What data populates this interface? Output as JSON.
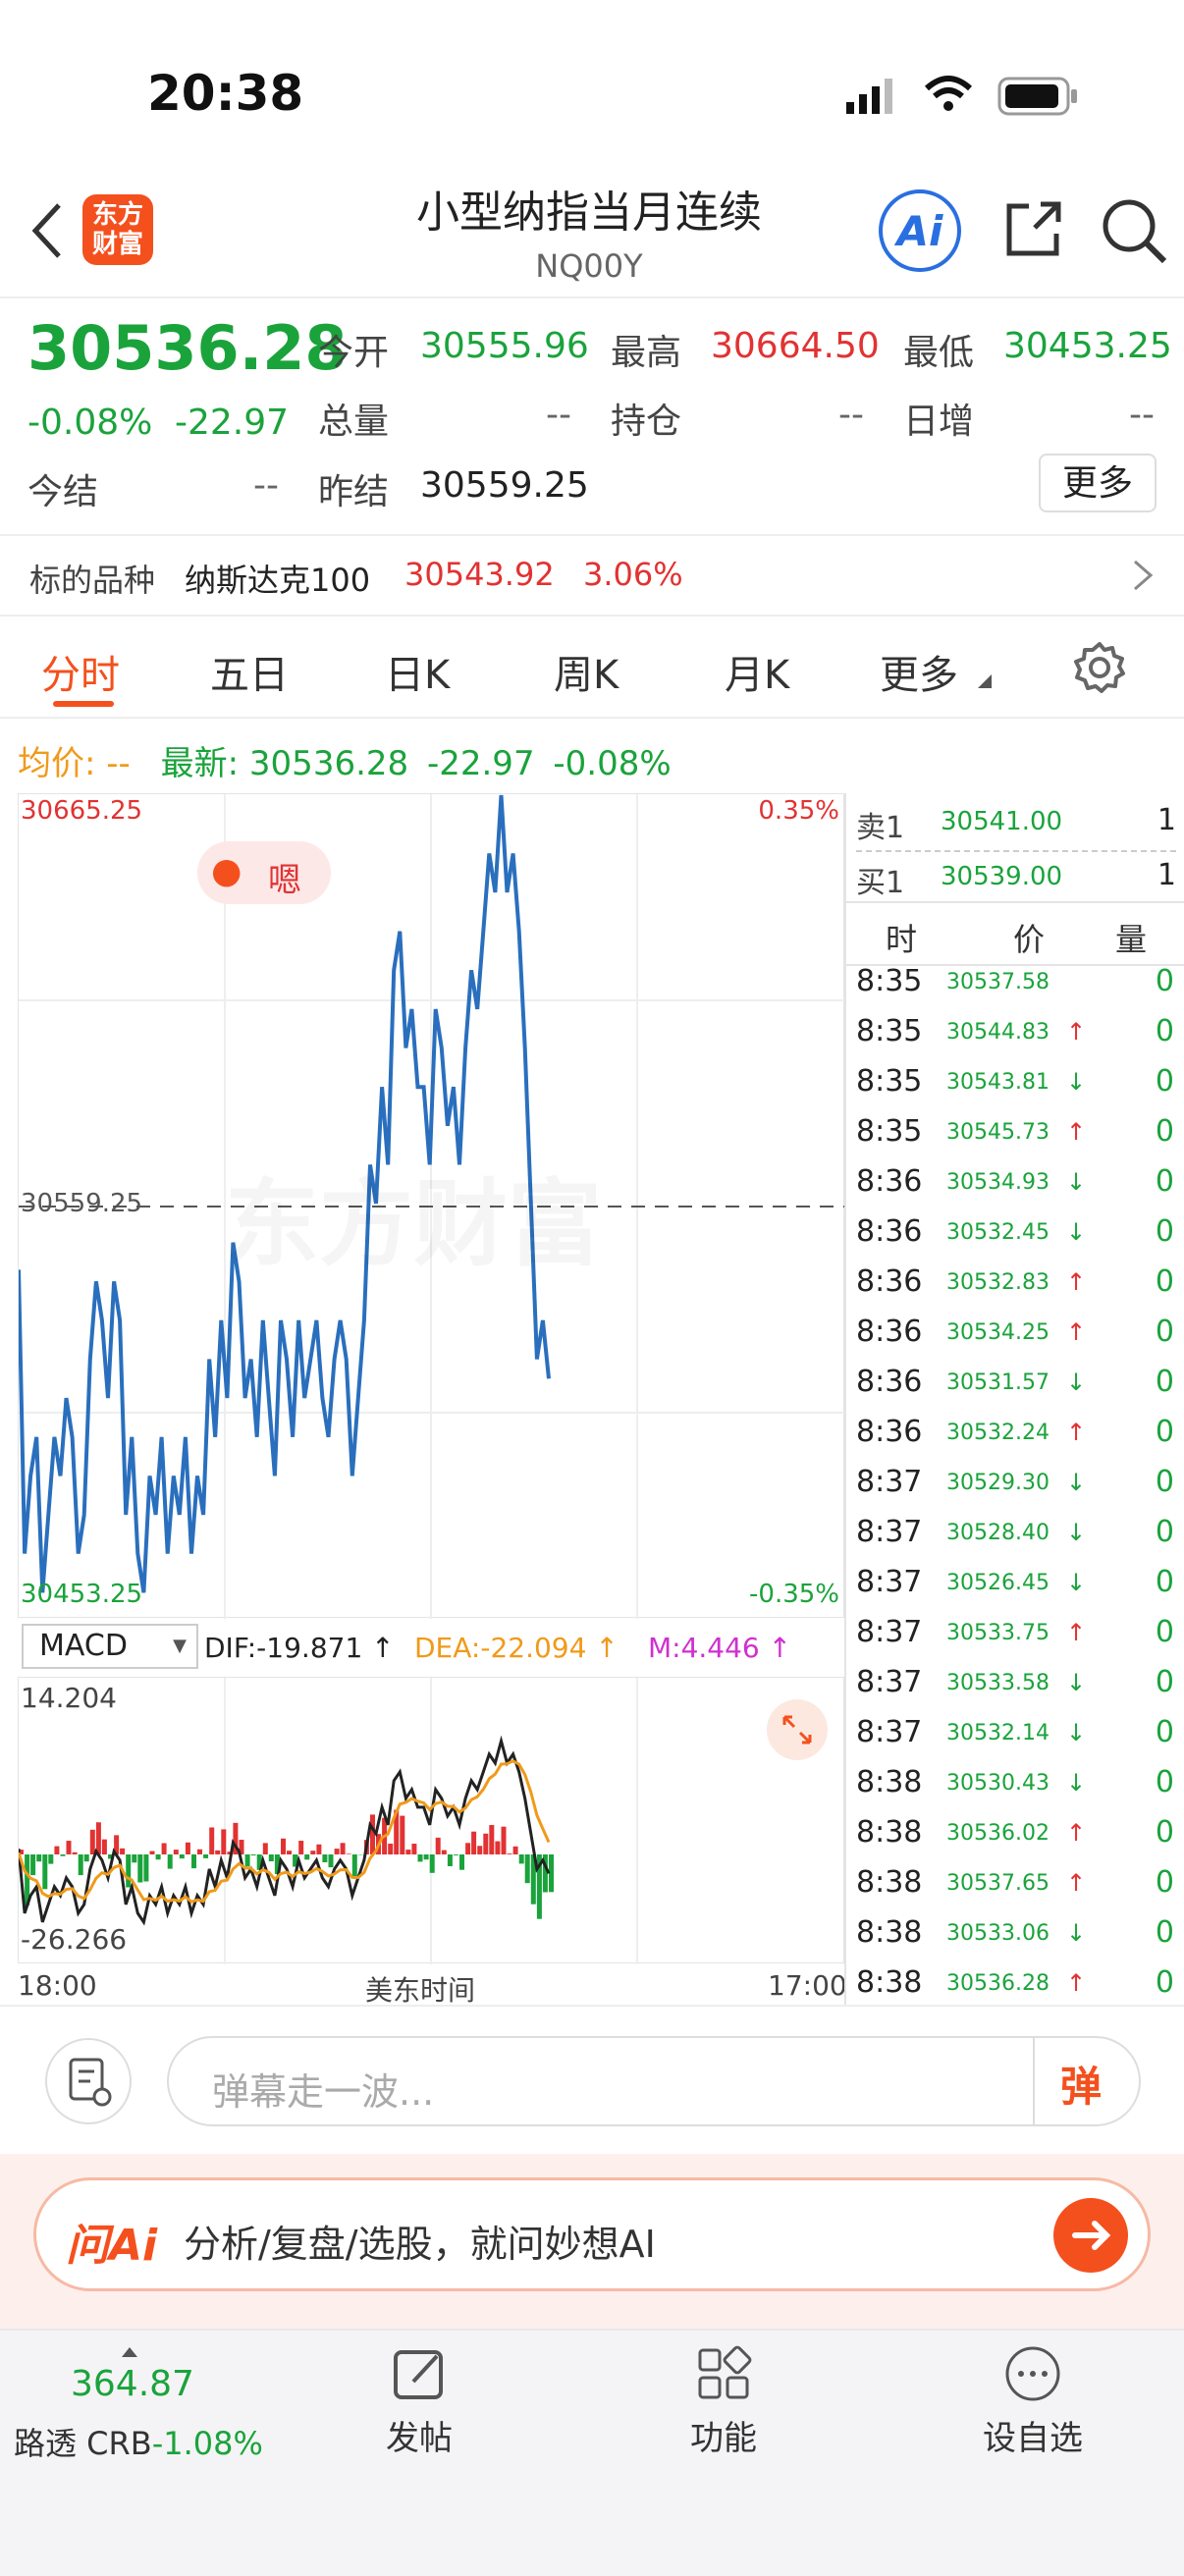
{
  "status_bar": {
    "time": "20:38"
  },
  "header": {
    "logo_line1": "东方",
    "logo_line2": "财富",
    "title": "小型纳指当月连续",
    "code": "NQ00Y",
    "ai_label": "Ai"
  },
  "quote": {
    "last": "30536.28",
    "change_pct": "-0.08%",
    "change": "-22.97",
    "open_label": "今开",
    "open": "30555.96",
    "high_label": "最高",
    "high": "30664.50",
    "low_label": "最低",
    "low": "30453.25",
    "volume_label": "总量",
    "volume": "--",
    "oi_label": "持仓",
    "oi": "--",
    "daily_inc_label": "日增",
    "daily_inc": "--",
    "settle_label": "今结",
    "settle": "--",
    "prev_settle_label": "昨结",
    "prev_settle": "30559.25",
    "more_button": "更多"
  },
  "underlying": {
    "label": "标的品种",
    "name": "纳斯达克100",
    "price": "30543.92",
    "pct": "3.06%"
  },
  "tabs": [
    "分时",
    "五日",
    "日K",
    "周K",
    "月K",
    "更多"
  ],
  "info_line": {
    "avg_label": "均价:",
    "avg_value": "--",
    "latest_label": "最新:",
    "latest_value": "30536.28",
    "change": "-22.97",
    "pct": "-0.08%"
  },
  "chart": {
    "y_max_label": "30665.25",
    "y_mid_label": "30559.25",
    "y_min_label": "30453.25",
    "pct_top": "0.35%",
    "pct_bottom": "-0.35%",
    "mascot_text": "嗯",
    "watermark": "东方财富"
  },
  "chart_data": {
    "type": "line",
    "title": "",
    "x_start_label": "18:00",
    "x_center_label": "美东时间",
    "x_end_label": "17:00",
    "ylim": [
      30453.25,
      30665.25
    ],
    "reference": 30559.25,
    "values": [
      30543,
      30470,
      30490,
      30500,
      30460,
      30480,
      30500,
      30490,
      30510,
      30500,
      30470,
      30480,
      30520,
      30540,
      30530,
      30510,
      30540,
      30530,
      30480,
      30500,
      30470,
      30460,
      30490,
      30480,
      30500,
      30470,
      30490,
      30480,
      30500,
      30470,
      30490,
      30480,
      30520,
      30500,
      30530,
      30510,
      30550,
      30540,
      30510,
      30520,
      30500,
      30530,
      30510,
      30490,
      30530,
      30520,
      30500,
      30530,
      30510,
      30520,
      30530,
      30510,
      30500,
      30520,
      30530,
      30520,
      30490,
      30510,
      30530,
      30570,
      30560,
      30590,
      30570,
      30620,
      30630,
      30600,
      30610,
      30590,
      30590,
      30570,
      30610,
      30600,
      30580,
      30590,
      30570,
      30600,
      30620,
      30610,
      30630,
      30650,
      30640,
      30665,
      30640,
      30650,
      30630,
      30600,
      30560,
      30520,
      30530,
      30515
    ]
  },
  "macd": {
    "label": "MACD",
    "dif": "DIF:-19.871 ↑",
    "dea": "DEA:-22.094 ↑",
    "m": "M:4.446 ↑",
    "y_max": "14.204",
    "y_min": "-26.266"
  },
  "order_book": {
    "sell_label": "卖1",
    "sell_price": "30541.00",
    "sell_vol": "1",
    "buy_label": "买1",
    "buy_price": "30539.00",
    "buy_vol": "1",
    "headers": [
      "时",
      "价",
      "量"
    ],
    "trades": [
      {
        "time": "8:35",
        "price": "30537.58",
        "dir": "",
        "vol": "0"
      },
      {
        "time": "8:35",
        "price": "30544.83",
        "dir": "↑",
        "vol": "0"
      },
      {
        "time": "8:35",
        "price": "30543.81",
        "dir": "↓",
        "vol": "0"
      },
      {
        "time": "8:35",
        "price": "30545.73",
        "dir": "↑",
        "vol": "0"
      },
      {
        "time": "8:36",
        "price": "30534.93",
        "dir": "↓",
        "vol": "0"
      },
      {
        "time": "8:36",
        "price": "30532.45",
        "dir": "↓",
        "vol": "0"
      },
      {
        "time": "8:36",
        "price": "30532.83",
        "dir": "↑",
        "vol": "0"
      },
      {
        "time": "8:36",
        "price": "30534.25",
        "dir": "↑",
        "vol": "0"
      },
      {
        "time": "8:36",
        "price": "30531.57",
        "dir": "↓",
        "vol": "0"
      },
      {
        "time": "8:36",
        "price": "30532.24",
        "dir": "↑",
        "vol": "0"
      },
      {
        "time": "8:37",
        "price": "30529.30",
        "dir": "↓",
        "vol": "0"
      },
      {
        "time": "8:37",
        "price": "30528.40",
        "dir": "↓",
        "vol": "0"
      },
      {
        "time": "8:37",
        "price": "30526.45",
        "dir": "↓",
        "vol": "0"
      },
      {
        "time": "8:37",
        "price": "30533.75",
        "dir": "↑",
        "vol": "0"
      },
      {
        "time": "8:37",
        "price": "30533.58",
        "dir": "↓",
        "vol": "0"
      },
      {
        "time": "8:37",
        "price": "30532.14",
        "dir": "↓",
        "vol": "0"
      },
      {
        "time": "8:38",
        "price": "30530.43",
        "dir": "↓",
        "vol": "0"
      },
      {
        "time": "8:38",
        "price": "30536.02",
        "dir": "↑",
        "vol": "0"
      },
      {
        "time": "8:38",
        "price": "30537.65",
        "dir": "↑",
        "vol": "0"
      },
      {
        "time": "8:38",
        "price": "30533.06",
        "dir": "↓",
        "vol": "0"
      },
      {
        "time": "8:38",
        "price": "30536.28",
        "dir": "↑",
        "vol": "0"
      }
    ]
  },
  "comment_bar": {
    "placeholder": "弹幕走一波...",
    "danmaku_label": "弹"
  },
  "ai_bar": {
    "brand": "问Ai",
    "text": "分析/复盘/选股，就问妙想AI"
  },
  "bottom_nav": {
    "ticker_value": "364.87",
    "ticker_name": "路透 CRB",
    "ticker_pct": "-1.08%",
    "items": [
      "发帖",
      "功能",
      "设自选"
    ]
  },
  "colors": {
    "up": "#e23232",
    "down": "#1aa33b",
    "accent": "#f4501e",
    "line": "#2a6fbd",
    "dea": "#f09a1a"
  }
}
